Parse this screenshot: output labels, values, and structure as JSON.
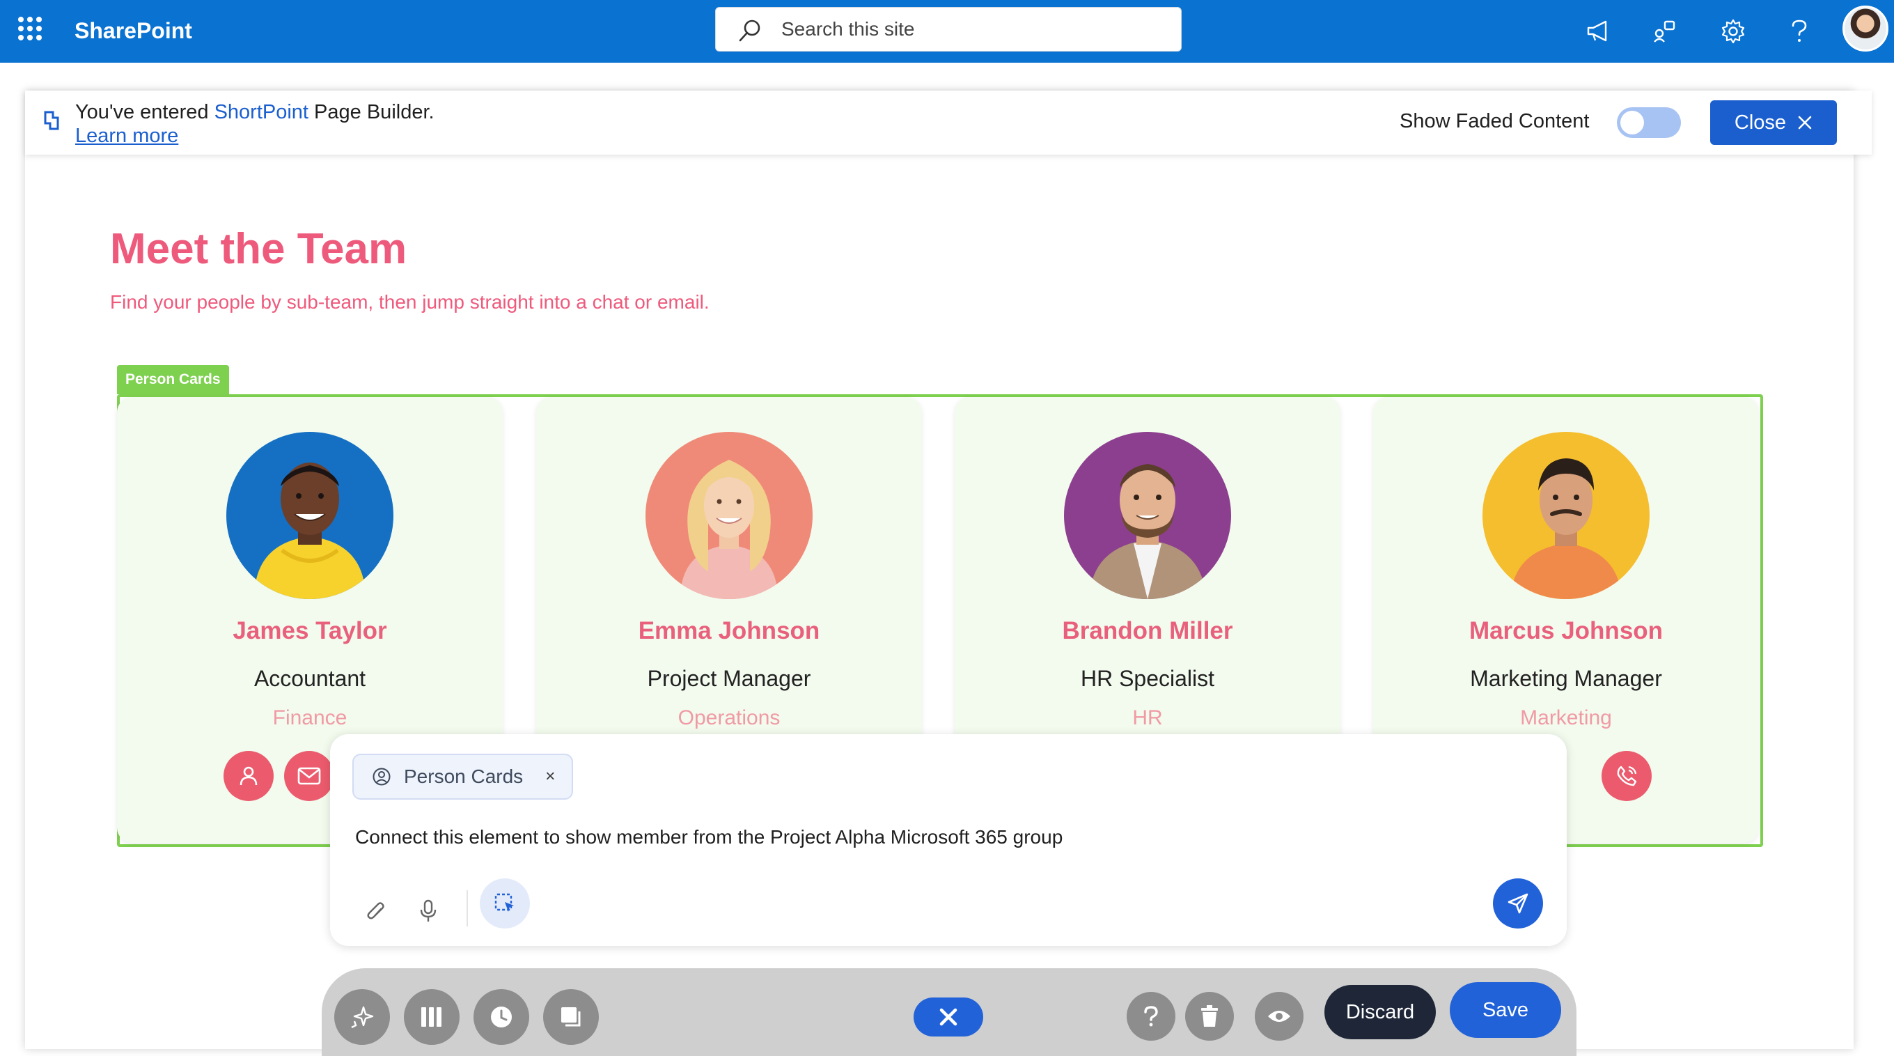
{
  "topbar": {
    "brand": "SharePoint",
    "search_placeholder": "Search this site",
    "accent": "#0a72d1",
    "icons": [
      "megaphone-icon",
      "share-icon",
      "gear-icon",
      "help-icon",
      "user-avatar"
    ]
  },
  "builder_banner": {
    "prefix": "You've entered ",
    "product": "ShortPoint",
    "suffix": " Page Builder.",
    "learn_more": "Learn more",
    "faded_label": "Show Faded Content",
    "faded_on": false,
    "close_label": "Close"
  },
  "page": {
    "title": "Meet the Team",
    "subtitle": "Find your people by sub-team, then jump straight into a chat or email."
  },
  "person_cards": {
    "tag": "Person Cards",
    "people": [
      {
        "name": "James Taylor",
        "role": "Accountant",
        "dept": "Finance",
        "bg": "#1570c4"
      },
      {
        "name": "Emma Johnson",
        "role": "Project Manager",
        "dept": "Operations",
        "bg": "#f08a78"
      },
      {
        "name": "Brandon Miller",
        "role": "HR Specialist",
        "dept": "HR",
        "bg": "#8d3f8f"
      },
      {
        "name": "Marcus Johnson",
        "role": "Marketing Manager",
        "dept": "Marketing",
        "bg": "#f5be2e"
      }
    ]
  },
  "prompt": {
    "chip_label": "Person Cards",
    "chip_close": "×",
    "text": "Connect this element to show member from the Project Alpha Microsoft 365 group"
  },
  "toolbar": {
    "discard": "Discard",
    "save": "Save"
  }
}
